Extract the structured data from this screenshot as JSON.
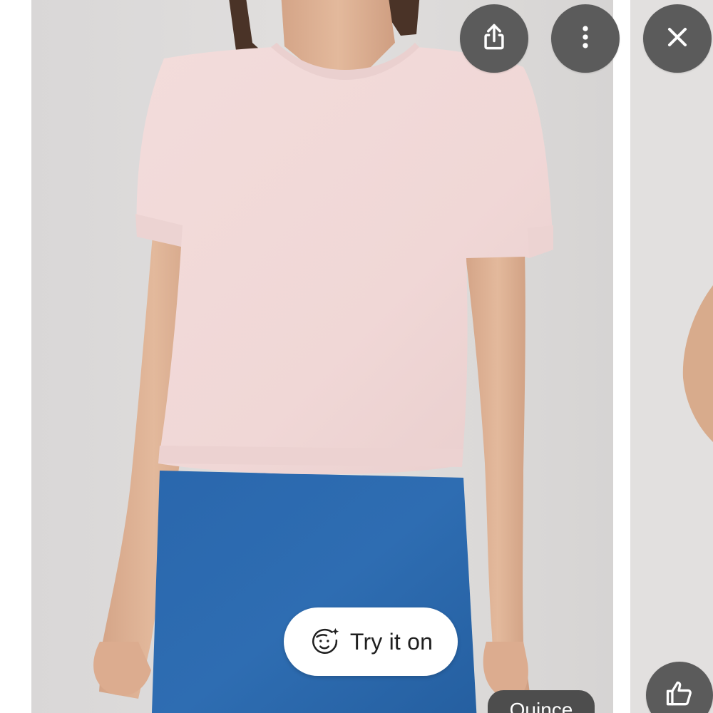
{
  "actions": {
    "share_icon": "share-icon",
    "more_icon": "more-vert-icon",
    "close_icon": "close-icon",
    "like_icon": "thumb-up-icon"
  },
  "try_on": {
    "label": "Try it on",
    "icon": "face-sparkle-icon"
  },
  "source": {
    "label": "Quince"
  },
  "colors": {
    "overlay_button": "#5b5b5b",
    "pill_background": "#ffffff",
    "chip_background": "#4d4d4d",
    "photo_background": "#dedcdc"
  }
}
